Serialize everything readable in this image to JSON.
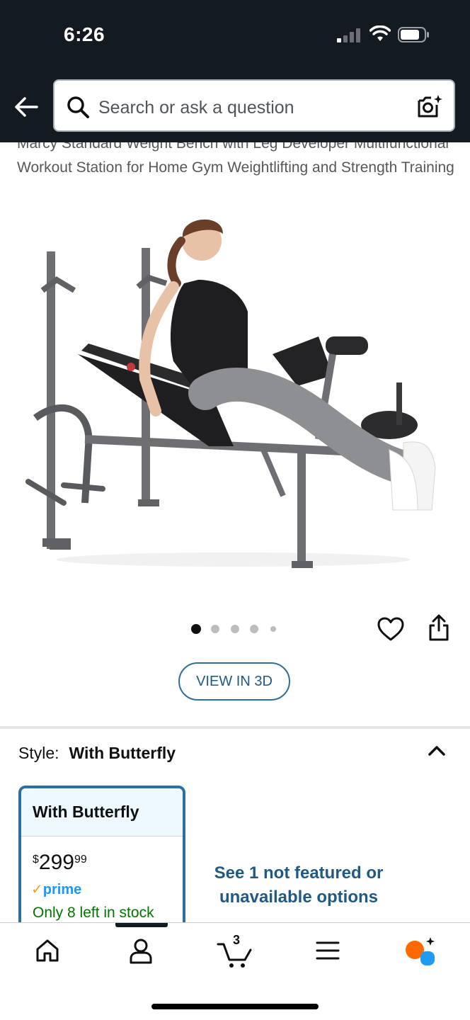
{
  "status_bar": {
    "time": "6:26"
  },
  "search": {
    "placeholder": "Search or ask a question"
  },
  "product": {
    "title": "Marcy Standard Weight Bench with Leg Developer Multifunctional Workout Station for Home Gym Weightlifting and Strength Training",
    "image_count": 5,
    "active_image": 0
  },
  "buttons": {
    "view_3d": "VIEW IN 3D"
  },
  "style": {
    "label": "Style:",
    "value": "With Butterfly",
    "options": [
      {
        "name": "With Butterfly",
        "price_symbol": "$",
        "price_whole": "299",
        "price_cents": "99",
        "prime_check": "✓",
        "prime": "prime",
        "stock": "Only 8 left in stock"
      }
    ],
    "more_options": "See 1 not featured or unavailable options"
  },
  "bottom_nav": {
    "cart_count": "3",
    "items": [
      "home-icon",
      "account-icon",
      "cart-icon",
      "menu-icon",
      "rufus-assistant-icon"
    ]
  },
  "colors": {
    "header_bg": "#131a22",
    "link_blue": "#1f5a85",
    "stock_green": "#007600",
    "prime_blue": "#1a98ff"
  }
}
